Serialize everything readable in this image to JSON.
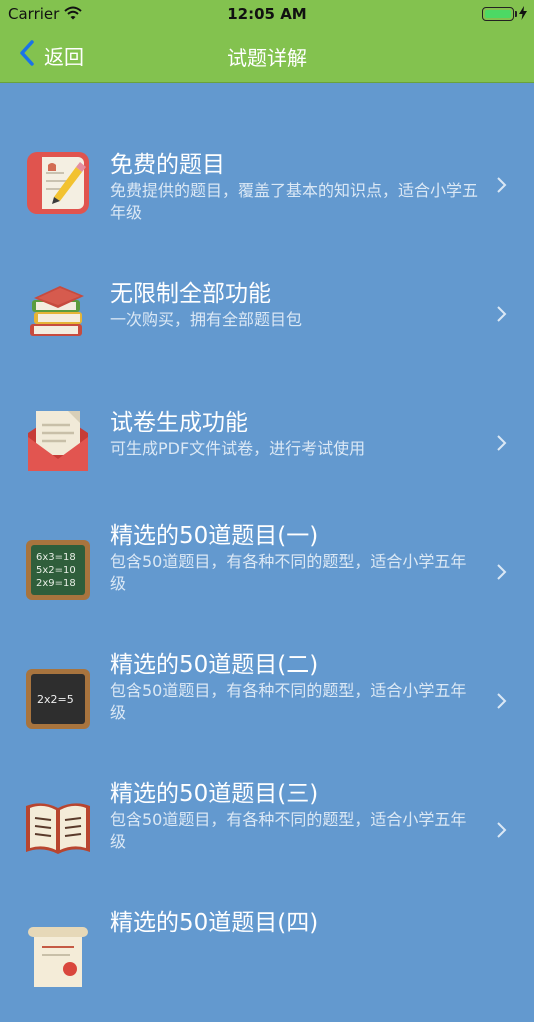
{
  "status_bar": {
    "carrier": "Carrier",
    "time": "12:05 AM"
  },
  "nav": {
    "back_label": "返回",
    "title": "试题详解"
  },
  "colors": {
    "nav_green": "#83c24f",
    "background_blue": "#6399cf"
  },
  "items": [
    {
      "icon": "notebook-pencil-icon",
      "title": "免费的题目",
      "subtitle": "免费提供的题目，覆盖了基本的知识点，适合小学五年级"
    },
    {
      "icon": "book-stack-icon",
      "title": "无限制全部功能",
      "subtitle": "一次购买，拥有全部题目包"
    },
    {
      "icon": "envelope-letter-icon",
      "title": "试卷生成功能",
      "subtitle": "可生成PDF文件试卷，进行考试使用"
    },
    {
      "icon": "chalkboard-multiplication-icon",
      "title": "精选的50道题目(一)",
      "subtitle": "包含50道题目，有各种不同的题型，适合小学五年级"
    },
    {
      "icon": "chalkboard-icon",
      "title": "精选的50道题目(二)",
      "subtitle": "包含50道题目，有各种不同的题型，适合小学五年级"
    },
    {
      "icon": "open-book-icon",
      "title": "精选的50道题目(三)",
      "subtitle": "包含50道题目，有各种不同的题型，适合小学五年级"
    },
    {
      "icon": "scroll-icon",
      "title": "精选的50道题目(四)",
      "subtitle": ""
    }
  ]
}
